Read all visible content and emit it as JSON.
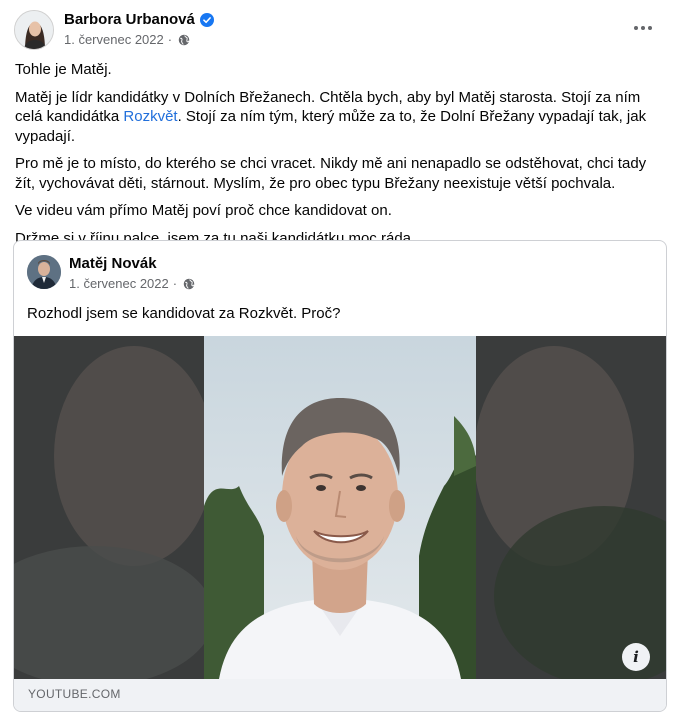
{
  "post": {
    "author": "Barbora Urbanová",
    "date": "1. červenec 2022",
    "separator": "·",
    "icons": {
      "verified": "verified-badge-icon",
      "audience": "globe-icon",
      "more": "more-options-icon"
    },
    "paragraphs": {
      "p1": "Tohle je Matěj.",
      "p2_a": "Matěj je lídr kandidátky v Dolních Břežanech. Chtěla bych, aby byl Matěj starosta. Stojí za ním celá kandidátka ",
      "p2_link": "Rozkvět",
      "p2_b": ". Stojí za ním tým, který může za to, že Dolní Břežany vypadají tak, jak vypadají.",
      "p3": "Pro mě je to místo, do kterého se chci vracet. Nikdy mě ani nenapadlo se odstěhovat, chci tady žít, vychovávat děti, stárnout. Myslím, že pro obec typu Břežany neexistuje větší pochvala.",
      "p4": "Ve videu vám přímo Matěj poví proč chce kandidovat on.",
      "p5": "Držme si v říjnu palce, jsem za tu naši kandidátku moc ráda."
    }
  },
  "shared_post": {
    "author": "Matěj Novák",
    "date": "1. červenec 2022",
    "separator": "·",
    "text": "Rozhodl jsem se kandidovat za Rozkvět. Proč?",
    "info_label": "i",
    "source": "YOUTUBE.COM"
  },
  "colors": {
    "link": "#216fdb",
    "verified": "#1877f2",
    "muted": "#65676b"
  }
}
